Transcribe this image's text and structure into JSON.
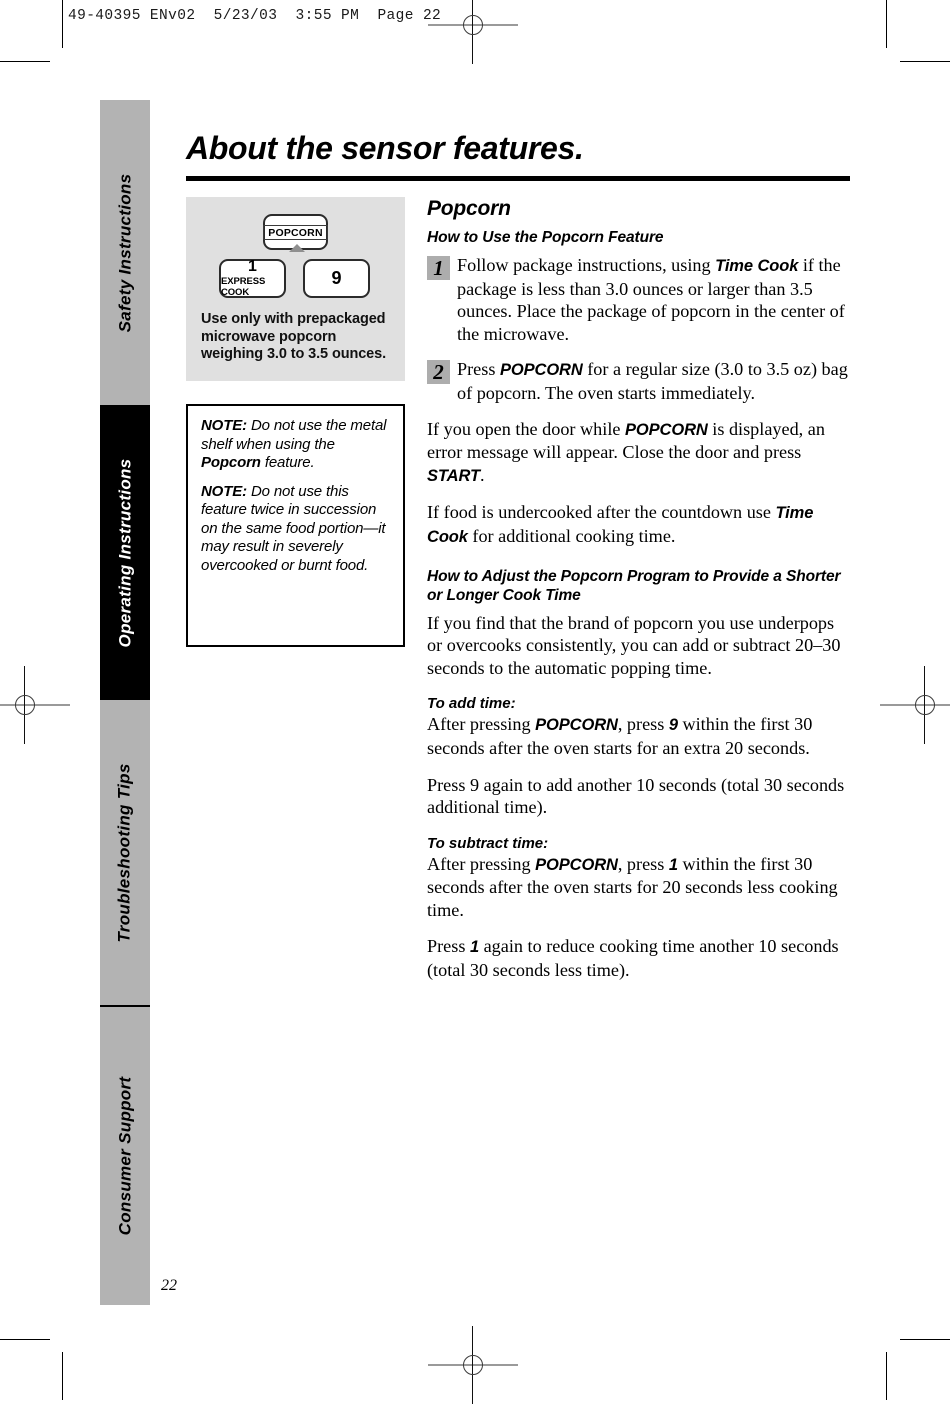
{
  "print_slug": "49-40395 ENv02  5/23/03  3:55 PM  Page 22",
  "page_title": "About the sensor features.",
  "folio": "22",
  "sidebar": {
    "tabs": [
      {
        "label": "Safety Instructions",
        "state": "inactive"
      },
      {
        "label": "Operating Instructions",
        "state": "active"
      },
      {
        "label": "Troubleshooting Tips",
        "state": "inactive"
      },
      {
        "label": "Consumer Support",
        "state": "inactive"
      }
    ]
  },
  "illustration": {
    "popcorn_button": "POPCORN",
    "one_button_number": "1",
    "one_button_sublabel": "EXPRESS COOK",
    "nine_button_number": "9",
    "caption": "Use only with prepackaged microwave popcorn weighing 3.0 to 3.5 ounces."
  },
  "notes": {
    "note1_label": "NOTE:",
    "note1_text_a": " Do not use the metal shelf when using the ",
    "note1_keyword": "Popcorn",
    "note1_text_b": " feature.",
    "note2_label": "NOTE:",
    "note2_text": " Do not use this feature twice in succession on the same food portion—it may result in severely overcooked or burnt food."
  },
  "content": {
    "heading": "Popcorn",
    "subheading_use": "How to Use the Popcorn Feature",
    "step1_num": "1",
    "step1_a": "Follow package instructions, using ",
    "step1_kw": "Time Cook",
    "step1_b": " if the package is less than 3.0 ounces or larger than 3.5 ounces. Place the package of popcorn in the center of the microwave.",
    "step2_num": "2",
    "step2_a": "Press ",
    "step2_kw": "POPCORN",
    "step2_b": " for a regular size (3.0 to 3.5 oz) bag of popcorn. The oven starts immediately.",
    "para_door_a": "If you open the door while ",
    "para_door_kw1": "POPCORN",
    "para_door_b": " is displayed, an error message will appear. Close the door and press ",
    "para_door_kw2": "START",
    "para_door_c": ".",
    "para_undercooked_a": "If food is undercooked after the countdown use ",
    "para_undercooked_kw": "Time Cook",
    "para_undercooked_b": " for additional cooking time.",
    "subheading_adjust": "How to Adjust the Popcorn Program to Provide a Shorter or Longer Cook Time",
    "para_brand": "If you find that the brand of popcorn you use underpops or overcooks consistently, you can add or subtract 20–30 seconds to the automatic popping time.",
    "add_label": "To add time:",
    "add_a": "After pressing ",
    "add_kw1": "POPCORN",
    "add_b": ", press ",
    "add_kw2": "9",
    "add_c": " within the first 30 seconds after the oven starts for an extra 20 seconds.",
    "add_again": "Press 9 again to add another 10 seconds (total 30 seconds additional time).",
    "sub_label": "To subtract time:",
    "sub_a": "After pressing ",
    "sub_kw1": "POPCORN",
    "sub_b": ", press ",
    "sub_kw2": "1",
    "sub_c": " within the first 30 seconds after the oven starts for 20 seconds less cooking time.",
    "sub_again_a": "Press ",
    "sub_again_kw": "1",
    "sub_again_b": " again to reduce cooking time another 10 seconds (total 30 seconds less time)."
  }
}
